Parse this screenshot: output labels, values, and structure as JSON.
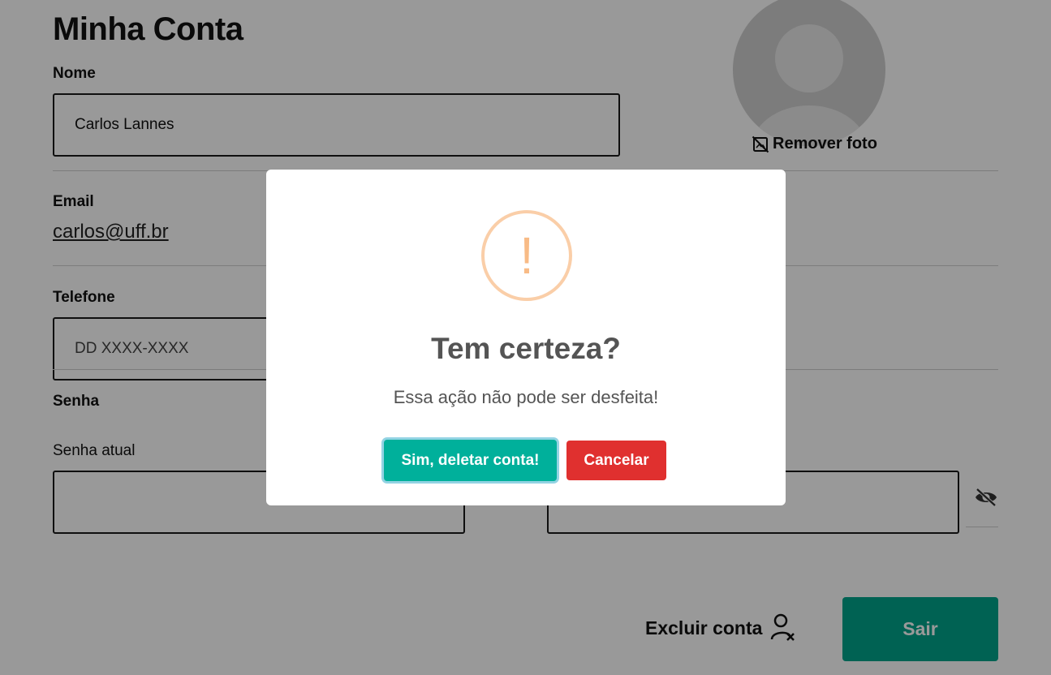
{
  "page": {
    "title": "Minha Conta"
  },
  "profile": {
    "name_label": "Nome",
    "name_value": "Carlos Lannes",
    "email_label": "Email",
    "email_value": "carlos@uff.br",
    "phone_label": "Telefone",
    "phone_placeholder": "DD XXXX-XXXX",
    "password_label": "Senha",
    "current_password_label": "Senha atual",
    "remove_photo_label": "Remover foto"
  },
  "actions": {
    "delete_account_label": "Excluir conta",
    "logout_label": "Sair"
  },
  "dialog": {
    "icon": "warning-exclamation",
    "icon_glyph": "!",
    "title": "Tem certeza?",
    "text": "Essa ação não pode ser desfeita!",
    "confirm_label": "Sim, deletar conta!",
    "cancel_label": "Cancelar"
  },
  "colors": {
    "primary": "#00a48a",
    "confirm": "#00b09b",
    "cancel": "#e0302f",
    "warning": "#f8bb86"
  }
}
